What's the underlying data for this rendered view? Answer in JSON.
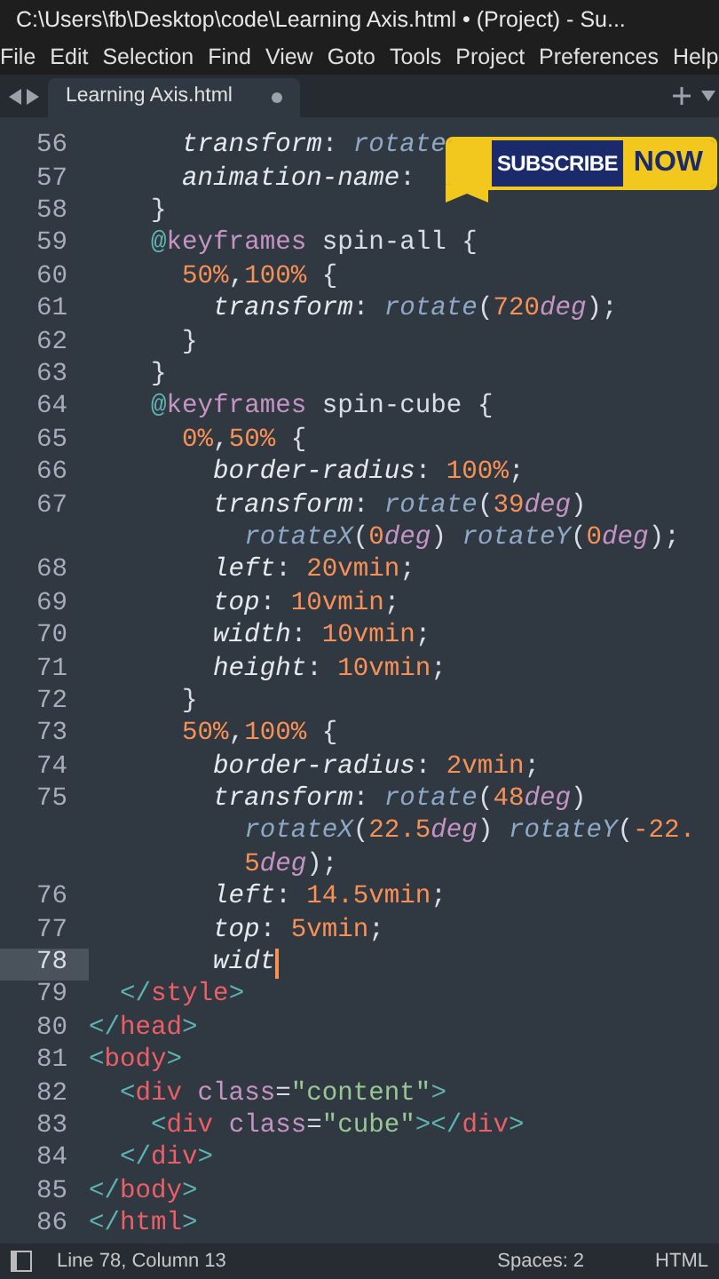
{
  "window": {
    "title": "C:\\Users\\fb\\Desktop\\code\\Learning Axis.html • (Project) - Su..."
  },
  "menu": [
    "File",
    "Edit",
    "Selection",
    "Find",
    "View",
    "Goto",
    "Tools",
    "Project",
    "Preferences",
    "Help"
  ],
  "tabs": [
    {
      "label": "Learning Axis.html",
      "selected": true,
      "dirty": true
    }
  ],
  "code": [
    {
      "number": "56",
      "current": false,
      "rows": [
        {
          "segments": [
            {
              "text": "      transform",
              "kind": "prop"
            },
            {
              "text": ": ",
              "kind": "plain"
            },
            {
              "text": "rotate",
              "kind": "fn"
            }
          ]
        }
      ]
    },
    {
      "number": "57",
      "current": false,
      "rows": [
        {
          "segments": [
            {
              "text": "      animation-name",
              "kind": "prop"
            },
            {
              "text": ":",
              "kind": "plain"
            }
          ]
        }
      ]
    },
    {
      "number": "58",
      "current": false,
      "rows": [
        {
          "segments": [
            {
              "text": "    }",
              "kind": "plain"
            }
          ]
        }
      ]
    },
    {
      "number": "59",
      "current": false,
      "rows": [
        {
          "segments": [
            {
              "text": "    @",
              "kind": "at"
            },
            {
              "text": "keyframes",
              "kind": "kw"
            },
            {
              "text": " spin-all {",
              "kind": "plain"
            }
          ]
        }
      ]
    },
    {
      "number": "60",
      "current": false,
      "rows": [
        {
          "segments": [
            {
              "text": "      50%",
              "kind": "num"
            },
            {
              "text": ",",
              "kind": "plain"
            },
            {
              "text": "100%",
              "kind": "num"
            },
            {
              "text": " {",
              "kind": "plain"
            }
          ]
        }
      ]
    },
    {
      "number": "61",
      "current": false,
      "rows": [
        {
          "segments": [
            {
              "text": "        transform",
              "kind": "prop"
            },
            {
              "text": ": ",
              "kind": "plain"
            },
            {
              "text": "rotate",
              "kind": "fn"
            },
            {
              "text": "(",
              "kind": "plain"
            },
            {
              "text": "720",
              "kind": "num"
            },
            {
              "text": "deg",
              "kind": "unit"
            },
            {
              "text": ");",
              "kind": "plain"
            }
          ]
        }
      ]
    },
    {
      "number": "62",
      "current": false,
      "rows": [
        {
          "segments": [
            {
              "text": "      }",
              "kind": "plain"
            }
          ]
        }
      ]
    },
    {
      "number": "63",
      "current": false,
      "rows": [
        {
          "segments": [
            {
              "text": "    }",
              "kind": "plain"
            }
          ]
        }
      ]
    },
    {
      "number": "64",
      "current": false,
      "rows": [
        {
          "segments": [
            {
              "text": "    @",
              "kind": "at"
            },
            {
              "text": "keyframes",
              "kind": "kw"
            },
            {
              "text": " spin-cube {",
              "kind": "plain"
            }
          ]
        }
      ]
    },
    {
      "number": "65",
      "current": false,
      "rows": [
        {
          "segments": [
            {
              "text": "      0%",
              "kind": "num"
            },
            {
              "text": ",",
              "kind": "plain"
            },
            {
              "text": "50%",
              "kind": "num"
            },
            {
              "text": " {",
              "kind": "plain"
            }
          ]
        }
      ]
    },
    {
      "number": "66",
      "current": false,
      "rows": [
        {
          "segments": [
            {
              "text": "        border-radius",
              "kind": "prop"
            },
            {
              "text": ": ",
              "kind": "plain"
            },
            {
              "text": "100%",
              "kind": "num"
            },
            {
              "text": ";",
              "kind": "plain"
            }
          ]
        }
      ]
    },
    {
      "number": "67",
      "current": false,
      "rows": [
        {
          "segments": [
            {
              "text": "        transform",
              "kind": "prop"
            },
            {
              "text": ": ",
              "kind": "plain"
            },
            {
              "text": "rotate",
              "kind": "fn"
            },
            {
              "text": "(",
              "kind": "plain"
            },
            {
              "text": "39",
              "kind": "num"
            },
            {
              "text": "deg",
              "kind": "unit"
            },
            {
              "text": ")",
              "kind": "plain"
            }
          ]
        },
        {
          "segments": [
            {
              "text": "          rotateX",
              "kind": "fn"
            },
            {
              "text": "(",
              "kind": "plain"
            },
            {
              "text": "0",
              "kind": "num"
            },
            {
              "text": "deg",
              "kind": "unit"
            },
            {
              "text": ") ",
              "kind": "plain"
            },
            {
              "text": "rotateY",
              "kind": "fn"
            },
            {
              "text": "(",
              "kind": "plain"
            },
            {
              "text": "0",
              "kind": "num"
            },
            {
              "text": "deg",
              "kind": "unit"
            },
            {
              "text": ");",
              "kind": "plain"
            }
          ]
        }
      ]
    },
    {
      "number": "68",
      "current": false,
      "rows": [
        {
          "segments": [
            {
              "text": "        left",
              "kind": "prop"
            },
            {
              "text": ": ",
              "kind": "plain"
            },
            {
              "text": "20vmin",
              "kind": "num"
            },
            {
              "text": ";",
              "kind": "plain"
            }
          ]
        }
      ]
    },
    {
      "number": "69",
      "current": false,
      "rows": [
        {
          "segments": [
            {
              "text": "        top",
              "kind": "prop"
            },
            {
              "text": ": ",
              "kind": "plain"
            },
            {
              "text": "10vmin",
              "kind": "num"
            },
            {
              "text": ";",
              "kind": "plain"
            }
          ]
        }
      ]
    },
    {
      "number": "70",
      "current": false,
      "rows": [
        {
          "segments": [
            {
              "text": "        width",
              "kind": "prop"
            },
            {
              "text": ": ",
              "kind": "plain"
            },
            {
              "text": "10vmin",
              "kind": "num"
            },
            {
              "text": ";",
              "kind": "plain"
            }
          ]
        }
      ]
    },
    {
      "number": "71",
      "current": false,
      "rows": [
        {
          "segments": [
            {
              "text": "        height",
              "kind": "prop"
            },
            {
              "text": ": ",
              "kind": "plain"
            },
            {
              "text": "10vmin",
              "kind": "num"
            },
            {
              "text": ";",
              "kind": "plain"
            }
          ]
        }
      ]
    },
    {
      "number": "72",
      "current": false,
      "rows": [
        {
          "segments": [
            {
              "text": "      }",
              "kind": "plain"
            }
          ]
        }
      ]
    },
    {
      "number": "73",
      "current": false,
      "rows": [
        {
          "segments": [
            {
              "text": "      50%",
              "kind": "num"
            },
            {
              "text": ",",
              "kind": "plain"
            },
            {
              "text": "100%",
              "kind": "num"
            },
            {
              "text": " {",
              "kind": "plain"
            }
          ]
        }
      ]
    },
    {
      "number": "74",
      "current": false,
      "rows": [
        {
          "segments": [
            {
              "text": "        border-radius",
              "kind": "prop"
            },
            {
              "text": ": ",
              "kind": "plain"
            },
            {
              "text": "2vmin",
              "kind": "num"
            },
            {
              "text": ";",
              "kind": "plain"
            }
          ]
        }
      ]
    },
    {
      "number": "75",
      "current": false,
      "rows": [
        {
          "segments": [
            {
              "text": "        transform",
              "kind": "prop"
            },
            {
              "text": ": ",
              "kind": "plain"
            },
            {
              "text": "rotate",
              "kind": "fn"
            },
            {
              "text": "(",
              "kind": "plain"
            },
            {
              "text": "48",
              "kind": "num"
            },
            {
              "text": "deg",
              "kind": "unit"
            },
            {
              "text": ")",
              "kind": "plain"
            }
          ]
        },
        {
          "segments": [
            {
              "text": "          rotateX",
              "kind": "fn"
            },
            {
              "text": "(",
              "kind": "plain"
            },
            {
              "text": "22.5",
              "kind": "num"
            },
            {
              "text": "deg",
              "kind": "unit"
            },
            {
              "text": ") ",
              "kind": "plain"
            },
            {
              "text": "rotateY",
              "kind": "fn"
            },
            {
              "text": "(",
              "kind": "plain"
            },
            {
              "text": "-22.",
              "kind": "num"
            }
          ]
        },
        {
          "segments": [
            {
              "text": "          5",
              "kind": "num"
            },
            {
              "text": "deg",
              "kind": "unit"
            },
            {
              "text": ");",
              "kind": "plain"
            }
          ]
        }
      ]
    },
    {
      "number": "76",
      "current": false,
      "rows": [
        {
          "segments": [
            {
              "text": "        left",
              "kind": "prop"
            },
            {
              "text": ": ",
              "kind": "plain"
            },
            {
              "text": "14.5vmin",
              "kind": "num"
            },
            {
              "text": ";",
              "kind": "plain"
            }
          ]
        }
      ]
    },
    {
      "number": "77",
      "current": false,
      "rows": [
        {
          "segments": [
            {
              "text": "        top",
              "kind": "prop"
            },
            {
              "text": ": ",
              "kind": "plain"
            },
            {
              "text": "5vmin",
              "kind": "num"
            },
            {
              "text": ";",
              "kind": "plain"
            }
          ]
        }
      ]
    },
    {
      "number": "78",
      "current": true,
      "rows": [
        {
          "segments": [
            {
              "text": "        widt",
              "kind": "prop"
            }
          ]
        }
      ]
    },
    {
      "number": "79",
      "current": false,
      "rows": [
        {
          "segments": [
            {
              "text": "  </",
              "kind": "punct"
            },
            {
              "text": "style",
              "kind": "tag"
            },
            {
              "text": ">",
              "kind": "punct"
            }
          ]
        }
      ]
    },
    {
      "number": "80",
      "current": false,
      "rows": [
        {
          "segments": [
            {
              "text": "</",
              "kind": "punct"
            },
            {
              "text": "head",
              "kind": "tag"
            },
            {
              "text": ">",
              "kind": "punct"
            }
          ]
        }
      ]
    },
    {
      "number": "81",
      "current": false,
      "rows": [
        {
          "segments": [
            {
              "text": "<",
              "kind": "punct"
            },
            {
              "text": "body",
              "kind": "tag"
            },
            {
              "text": ">",
              "kind": "punct"
            }
          ]
        }
      ]
    },
    {
      "number": "82",
      "current": false,
      "rows": [
        {
          "segments": [
            {
              "text": "  <",
              "kind": "punct"
            },
            {
              "text": "div ",
              "kind": "tag"
            },
            {
              "text": "class",
              "kind": "attr"
            },
            {
              "text": "=",
              "kind": "plain"
            },
            {
              "text": "\"content\"",
              "kind": "str"
            },
            {
              "text": ">",
              "kind": "punct"
            }
          ]
        }
      ]
    },
    {
      "number": "83",
      "current": false,
      "rows": [
        {
          "segments": [
            {
              "text": "    <",
              "kind": "punct"
            },
            {
              "text": "div ",
              "kind": "tag"
            },
            {
              "text": "class",
              "kind": "attr"
            },
            {
              "text": "=",
              "kind": "plain"
            },
            {
              "text": "\"cube\"",
              "kind": "str"
            },
            {
              "text": "></",
              "kind": "punct"
            },
            {
              "text": "div",
              "kind": "tag"
            },
            {
              "text": ">",
              "kind": "punct"
            }
          ]
        }
      ]
    },
    {
      "number": "84",
      "current": false,
      "rows": [
        {
          "segments": [
            {
              "text": "  </",
              "kind": "punct"
            },
            {
              "text": "div",
              "kind": "tag"
            },
            {
              "text": ">",
              "kind": "punct"
            }
          ]
        }
      ]
    },
    {
      "number": "85",
      "current": false,
      "rows": [
        {
          "segments": [
            {
              "text": "</",
              "kind": "punct"
            },
            {
              "text": "body",
              "kind": "tag"
            },
            {
              "text": ">",
              "kind": "punct"
            }
          ]
        }
      ]
    },
    {
      "number": "86",
      "current": false,
      "rows": [
        {
          "segments": [
            {
              "text": "</",
              "kind": "punct"
            },
            {
              "text": "html",
              "kind": "tag"
            },
            {
              "text": ">",
              "kind": "punct"
            }
          ]
        }
      ]
    }
  ],
  "overlay": {
    "left": "SUBSCRIBE",
    "right": "NOW"
  },
  "status_bar": {
    "position": "Line 78, Column 13",
    "indentation": "Spaces: 2",
    "syntax": "HTML"
  }
}
